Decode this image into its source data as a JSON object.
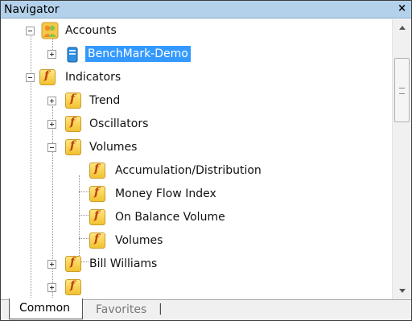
{
  "window": {
    "title": "Navigator",
    "close_label": "×"
  },
  "tree": {
    "accounts_label": "Accounts",
    "account_item_label": "BenchMark-Demo",
    "indicators_label": "Indicators",
    "trend_label": "Trend",
    "oscillators_label": "Oscillators",
    "volumes_label": "Volumes",
    "volume_items": [
      "Accumulation/Distribution",
      "Money Flow Index",
      "On Balance Volume",
      "Volumes"
    ],
    "bill_williams_label": "Bill Williams",
    "icon_glyph": "f"
  },
  "tabs": {
    "common": "Common",
    "favorites": "Favorites",
    "separator": "|"
  }
}
